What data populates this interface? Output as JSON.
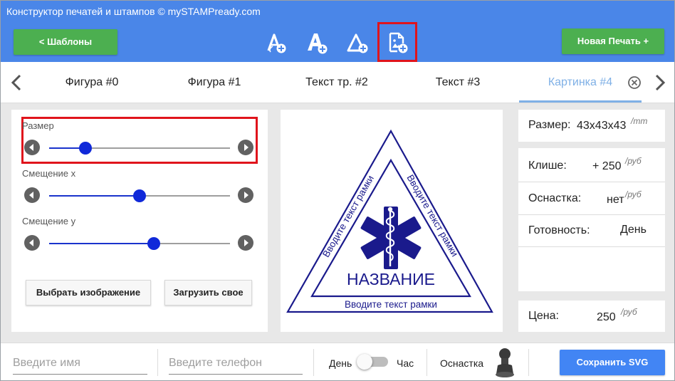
{
  "window": {
    "title": "Конструктор печатей и штампов © mySTAMPready.com"
  },
  "toolbar": {
    "templates_label": "<   Шаблоны",
    "new_stamp_label": "Новая Печать +",
    "tools": [
      {
        "icon": "add-circle-text-icon"
      },
      {
        "icon": "add-text-icon"
      },
      {
        "icon": "add-triangle-text-icon"
      },
      {
        "icon": "add-image-icon",
        "highlighted": true
      }
    ]
  },
  "tabs": {
    "items": [
      {
        "label": "Фигура #0"
      },
      {
        "label": "Фигура #1"
      },
      {
        "label": "Текст тр. #2"
      },
      {
        "label": "Текст #3"
      },
      {
        "label": "Картинка #4",
        "active": true
      }
    ]
  },
  "sliders": {
    "size": {
      "label": "Размер",
      "value": 0.2
    },
    "offset_x": {
      "label": "Смещение x",
      "value": 0.5
    },
    "offset_y": {
      "label": "Смещение y",
      "value": 0.58
    }
  },
  "buttons": {
    "choose_image": "Выбрать изображение",
    "upload_own": "Загрузить свое"
  },
  "preview": {
    "left_text": "Вводите текст рамки",
    "right_text": "Вводите текст рамки",
    "bottom_text": "Вводите текст рамки",
    "name": "НАЗВАНИЕ",
    "color": "#1a1a8c"
  },
  "info": {
    "size_label": "Размер:",
    "size_value": "43x43x43",
    "size_unit": "/mm",
    "cliche_label": "Клише:",
    "cliche_value": "+ 250",
    "cliche_unit": "/руб",
    "mount_label": "Оснастка:",
    "mount_value": "нет",
    "mount_unit": "/руб",
    "ready_label": "Готовность:",
    "ready_value": "День",
    "price_label": "Цена:",
    "price_value": "250",
    "price_unit": "/руб"
  },
  "bottom": {
    "name_placeholder": "Введите имя",
    "phone_placeholder": "Введите телефон",
    "day_label": "День",
    "hour_label": "Час",
    "mount_label": "Оснастка",
    "save_label": "Сохранить SVG"
  },
  "colors": {
    "header_blue": "#4a86e8",
    "green": "#4caf50",
    "highlight_red": "#e0141c",
    "active_tab": "#7fb0e6",
    "slider_blue": "#1029d9",
    "save_blue": "#4285f4"
  }
}
